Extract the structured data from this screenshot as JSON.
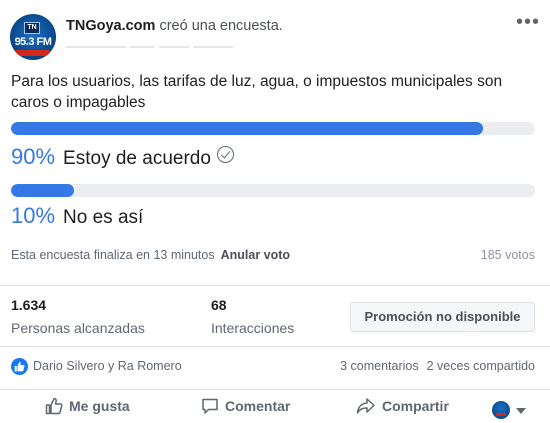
{
  "header": {
    "page_name": "TNGoya.com",
    "action_text": " creó una encuesta.",
    "avatar_freq": "95.3 FM",
    "avatar_badge": "TN"
  },
  "poll": {
    "question": "Para los usuarios, las tarifas de luz, agua, o impuestos municipales son caros o impagables",
    "options": [
      {
        "percent_label": "90%",
        "label": "Estoy de acuerdo",
        "fill_fraction": 0.9,
        "voted": true
      },
      {
        "percent_label": "10%",
        "label": "No es así",
        "fill_fraction": 0.12,
        "voted": false
      }
    ],
    "ends_text": "Esta encuesta finaliza en 13 minutos",
    "undo_label": "Anular voto",
    "votes_text": "185 votos",
    "accent_color": "#3578e5"
  },
  "stats": {
    "reach_value": "1.634",
    "reach_label": "Personas alcanzadas",
    "interactions_value": "68",
    "interactions_label": "Interacciones",
    "promo_label": "Promoción no disponible"
  },
  "engagement": {
    "reaction_icon": "like-icon",
    "reactors_text": "Dario Silvero y Ra Romero",
    "comments_text": "3 comentarios",
    "shares_text": "2 veces compartido"
  },
  "actions": {
    "like_label": "Me gusta",
    "comment_label": "Comentar",
    "share_label": "Compartir"
  }
}
